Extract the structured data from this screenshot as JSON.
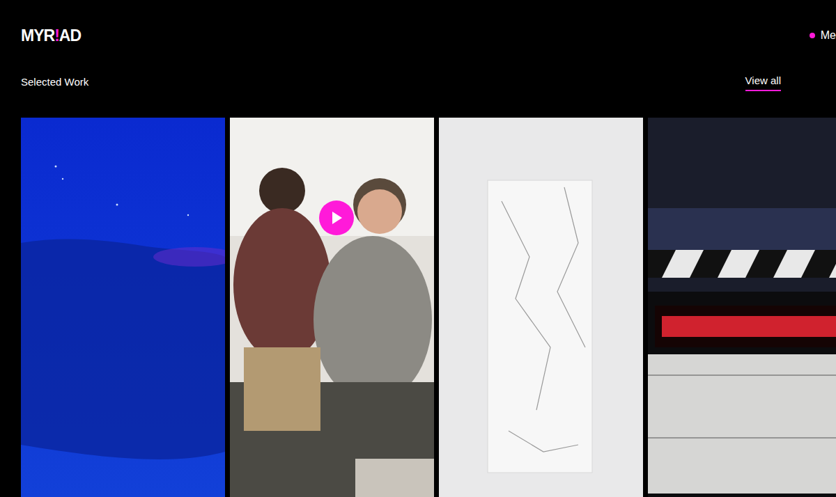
{
  "logo": {
    "parts": [
      {
        "text": "MYR",
        "color": "#ffffff"
      },
      {
        "text": "!",
        "color": "#ff1ad9"
      },
      {
        "text": "AD",
        "color": "#ffffff"
      }
    ]
  },
  "nav": {
    "label": "Me"
  },
  "section": {
    "title": "Selected Work",
    "link": "View all"
  },
  "works": [
    {
      "kind": "image",
      "color": "#0b2fd4"
    },
    {
      "kind": "video",
      "color": "#d9d4cc"
    },
    {
      "kind": "image",
      "color": "#e9e9ea"
    },
    {
      "kind": "image",
      "color": "#1a1d2b"
    }
  ]
}
